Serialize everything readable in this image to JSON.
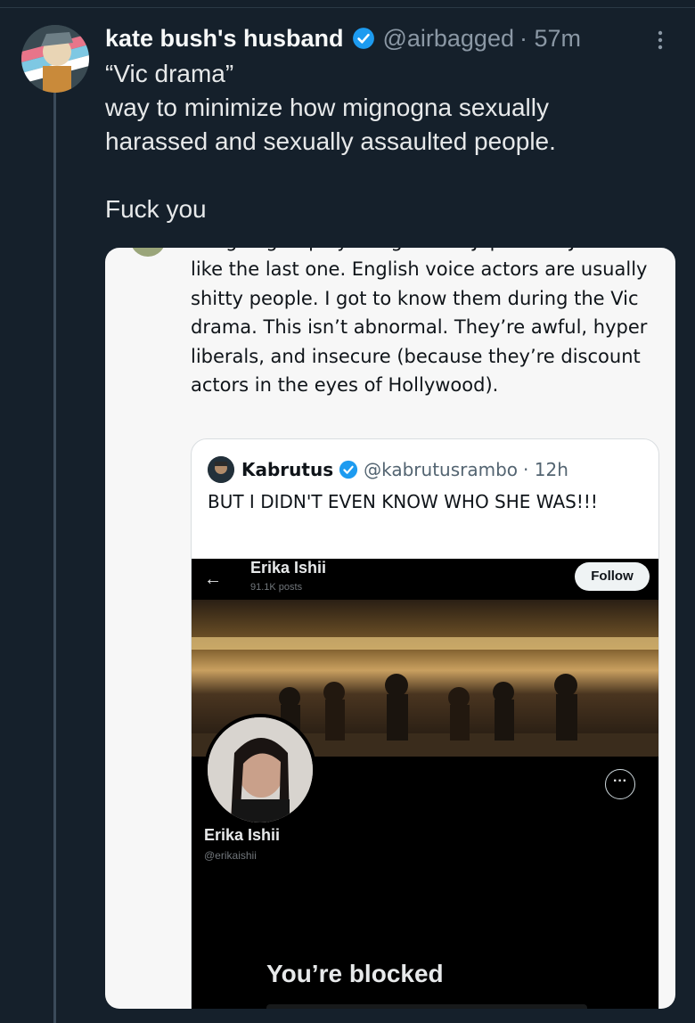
{
  "tweet": {
    "author_name": "kate bush's husband",
    "handle": "@airbagged",
    "time": "· 57m",
    "lines": [
      "“Vic drama”",
      "way to minimize how mignogna sexually",
      "harassed and sexually assaulted people.",
      "Fuck you"
    ]
  },
  "card": {
    "cut_line": "I'm going to play the game in Japanese. Just",
    "text": "like the last one. English voice actors are usually shitty people. I got to know them during the Vic drama. This isn’t abnormal. They’re awful, hyper liberals, and insecure (because they’re discount actors in the eyes of Hollywood).",
    "quote": {
      "name": "Kabrutus",
      "handle": "@kabrutusrambo",
      "time": "· 12h",
      "text": "BUT I DIDN'T EVEN KNOW WHO SHE WAS!!!"
    },
    "screenshot": {
      "header_name": "Erika Ishii",
      "post_count": "91.1K posts",
      "follow_label": "Follow",
      "profile_name": "Erika Ishii",
      "profile_handle": "@erikaishii",
      "blocked_message": "You’re blocked"
    }
  },
  "colors": {
    "background": "#15202b",
    "verified_blue": "#1d9bf0",
    "muted_text": "#8b98a5"
  }
}
